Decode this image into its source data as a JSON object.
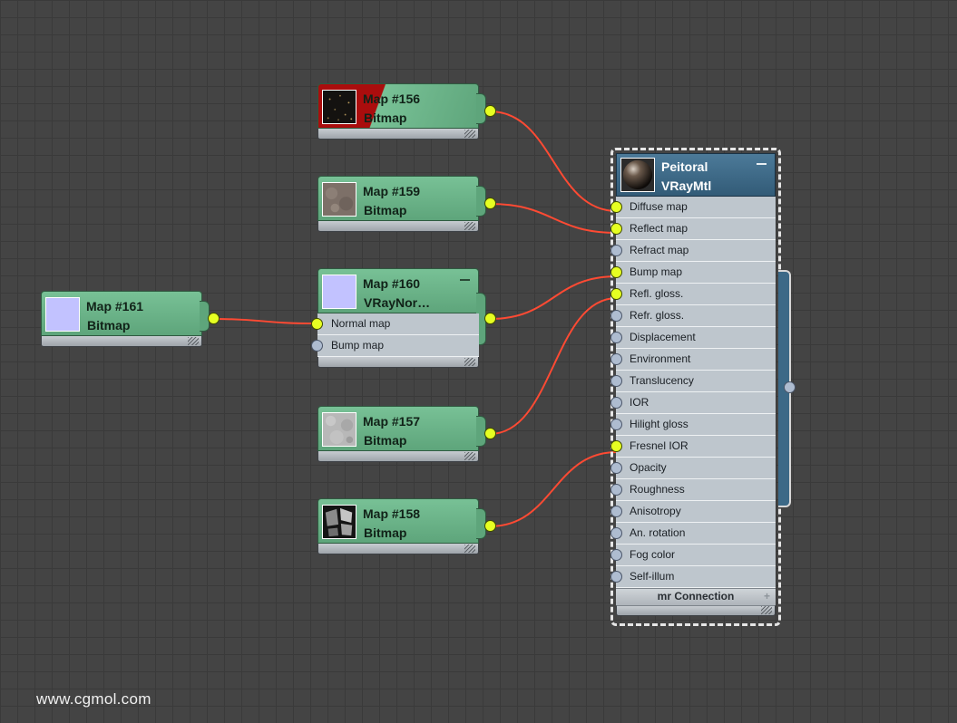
{
  "watermark": "www.cgmol.com",
  "colors": {
    "background": "#444444",
    "map_node": "#6db48a",
    "material_header": "#3f6d8c",
    "wire": "#ff4a33",
    "socket_connected": "#e6ff22",
    "socket_empty": "#aebcd0"
  },
  "map_nodes": {
    "map156": {
      "title": "Map #156",
      "type": "Bitmap",
      "thumbnail": "dark-speckled-texture"
    },
    "map159": {
      "title": "Map #159",
      "type": "Bitmap",
      "thumbnail": "stone-texture"
    },
    "map160": {
      "title": "Map #160",
      "type": "VRayNor…",
      "thumbnail": "normal-map-lavender",
      "slots": [
        {
          "label": "Normal map",
          "connected": true
        },
        {
          "label": "Bump map",
          "connected": false
        }
      ]
    },
    "map161": {
      "title": "Map #161",
      "type": "Bitmap",
      "thumbnail": "normal-map-lavender"
    },
    "map157": {
      "title": "Map #157",
      "type": "Bitmap",
      "thumbnail": "grey-noise-texture"
    },
    "map158": {
      "title": "Map #158",
      "type": "Bitmap",
      "thumbnail": "black-white-panels-texture"
    }
  },
  "material": {
    "name": "Peitoral",
    "type": "VRayMtl",
    "thumbnail": "material-sphere",
    "footer": "mr Connection",
    "slots": [
      {
        "label": "Diffuse map",
        "connected": true
      },
      {
        "label": "Reflect map",
        "connected": true
      },
      {
        "label": "Refract map",
        "connected": false
      },
      {
        "label": "Bump map",
        "connected": true
      },
      {
        "label": "Refl. gloss.",
        "connected": true
      },
      {
        "label": "Refr. gloss.",
        "connected": false
      },
      {
        "label": "Displacement",
        "connected": false
      },
      {
        "label": "Environment",
        "connected": false
      },
      {
        "label": "Translucency",
        "connected": false
      },
      {
        "label": "IOR",
        "connected": false
      },
      {
        "label": "Hilight gloss",
        "connected": false
      },
      {
        "label": "Fresnel IOR",
        "connected": true
      },
      {
        "label": "Opacity",
        "connected": false
      },
      {
        "label": "Roughness",
        "connected": false
      },
      {
        "label": "Anisotropy",
        "connected": false
      },
      {
        "label": "An. rotation",
        "connected": false
      },
      {
        "label": "Fog color",
        "connected": false
      },
      {
        "label": "Self-illum",
        "connected": false
      }
    ]
  }
}
